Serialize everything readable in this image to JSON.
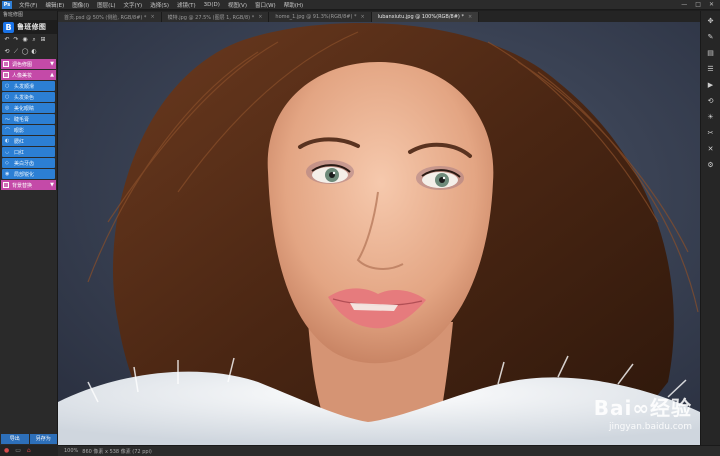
{
  "menubar": {
    "logo": "Ps",
    "items": [
      "文件(F)",
      "编辑(E)",
      "图像(I)",
      "图层(L)",
      "文字(Y)",
      "选择(S)",
      "滤镜(T)",
      "3D(D)",
      "视图(V)",
      "窗口(W)",
      "帮助(H)"
    ],
    "window_controls": [
      "—",
      "□",
      "✕"
    ]
  },
  "tabs": [
    {
      "label": "首页.psd @ 50% (侧脸, RGB/8#) *",
      "active": false
    },
    {
      "label": "模特.jpg @ 27.5% (图层 1, RGB/8) *",
      "active": false
    },
    {
      "label": "home_1.jpg @ 91.3%(RGB/8#) *",
      "active": false
    },
    {
      "label": "lubanxiutu.jpg @ 100%(RGB/8#) *",
      "active": true
    }
  ],
  "left_panel": {
    "title": "鲁班修图",
    "brand_logo": "B",
    "brand_name": "鲁班修图",
    "tool_icons": [
      "↶",
      "↷",
      "◉",
      "⌕",
      "⊞"
    ],
    "tool_icons2": [
      "⟲",
      "⟋",
      "◯",
      "◐"
    ],
    "sections": [
      {
        "label": "调色修图",
        "collapsed": true
      },
      {
        "label": "人像美妆",
        "collapsed": false
      },
      {
        "label": "背景替换",
        "collapsed": true
      }
    ],
    "items": [
      {
        "icon": "○",
        "label": "头发顺滑"
      },
      {
        "icon": "○",
        "label": "头发染色"
      },
      {
        "icon": "◎",
        "label": "美化眼睛"
      },
      {
        "icon": "～",
        "label": "睫毛膏"
      },
      {
        "icon": "⌒",
        "label": "眼影"
      },
      {
        "icon": "◐",
        "label": "腮红"
      },
      {
        "icon": "◡",
        "label": "口红"
      },
      {
        "icon": "◇",
        "label": "美白牙齿"
      },
      {
        "icon": "◉",
        "label": "局部锐化"
      }
    ],
    "bottom_buttons": [
      "导出",
      "另存为"
    ]
  },
  "statusbar": {
    "zoom": "100%",
    "doc_info": "860 像素 x 538 像素 (72 ppi)"
  },
  "watermark": {
    "main": "Bai∞经验",
    "sub": "jingyan.baidu.com"
  },
  "colors": {
    "accent_blue": "#2c7fd4",
    "section_pink": "#c44aa8",
    "background_gray": "#3c4658"
  }
}
